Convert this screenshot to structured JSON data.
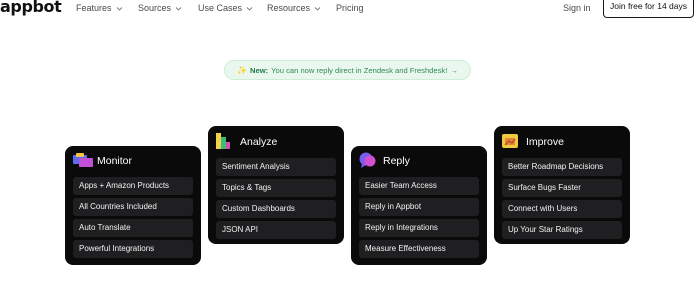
{
  "nav": {
    "logo": "appbot",
    "items": [
      {
        "label": "Features",
        "has_dropdown": true
      },
      {
        "label": "Sources",
        "has_dropdown": true
      },
      {
        "label": "Use Cases",
        "has_dropdown": true
      },
      {
        "label": "Resources",
        "has_dropdown": true
      },
      {
        "label": "Pricing",
        "has_dropdown": false
      }
    ],
    "signin": "Sign in",
    "cta": "Join free for 14 days"
  },
  "announcement": {
    "icon": "sparkle-icon",
    "prefix": "New:",
    "text": "You can now reply direct in Zendesk and Freshdesk!",
    "arrow": "→"
  },
  "cards": [
    {
      "title": "Monitor",
      "icon": "monitor-icon",
      "items": [
        "Apps + Amazon Products",
        "All Countries Included",
        "Auto Translate",
        "Powerful Integrations"
      ]
    },
    {
      "title": "Analyze",
      "icon": "analyze-icon",
      "items": [
        "Sentiment Analysis",
        "Topics & Tags",
        "Custom Dashboards",
        "JSON API"
      ]
    },
    {
      "title": "Reply",
      "icon": "reply-icon",
      "items": [
        "Easier Team Access",
        "Reply in Appbot",
        "Reply in Integrations",
        "Measure Effectiveness"
      ]
    },
    {
      "title": "Improve",
      "icon": "improve-icon",
      "items": [
        "Better Roadmap Decisions",
        "Surface Bugs Faster",
        "Connect with Users",
        "Up Your Star Ratings"
      ]
    }
  ],
  "colors": {
    "card_bg": "#0a0a0a",
    "row_bg": "#1f1f21",
    "pill_bg": "#eaf7ee",
    "pill_text": "#2f8a55"
  }
}
